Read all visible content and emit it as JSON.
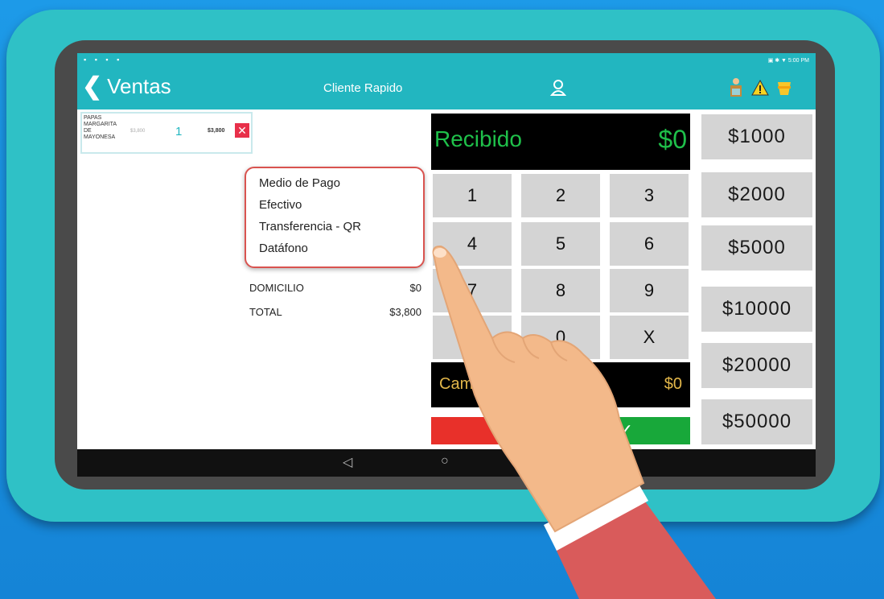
{
  "status": {
    "left": "▪ ▪ ▪ ▪",
    "right": "▣ ✱ ▼ 5:00 PM"
  },
  "appbar": {
    "title": "Ventas",
    "client": "Cliente Rapido"
  },
  "item": {
    "name": "PAPAS MARGARITA DE MAYONESA",
    "old_price": "$3,800",
    "qty": "1",
    "price": "$3,800",
    "delete": "✕"
  },
  "payment_menu": [
    "Medio de Pago",
    "Efectivo",
    "Transferencia - QR",
    "Datáfono"
  ],
  "totals": {
    "domicilio_label": "DOMICILIO",
    "domicilio_value": "$0",
    "total_label": "TOTAL",
    "total_value": "$3,800"
  },
  "recibido": {
    "label": "Recibido",
    "value": "$0"
  },
  "keypad": [
    "1",
    "2",
    "3",
    "4",
    "5",
    "6",
    "7",
    "8",
    "9",
    "",
    "0",
    "X"
  ],
  "cambio": {
    "label": "Cambio",
    "value": "$0"
  },
  "confirm": "✓",
  "quick_amounts": [
    "$1000",
    "$2000",
    "$5000",
    "$10000",
    "$20000",
    "$50000"
  ],
  "navbar": {
    "back": "◁",
    "home": "○"
  },
  "colors": {
    "teal": "#22b6c0",
    "case": "#2fc1c6",
    "green": "#1fc04a",
    "red": "#e8302a",
    "gold": "#e3b74a"
  }
}
